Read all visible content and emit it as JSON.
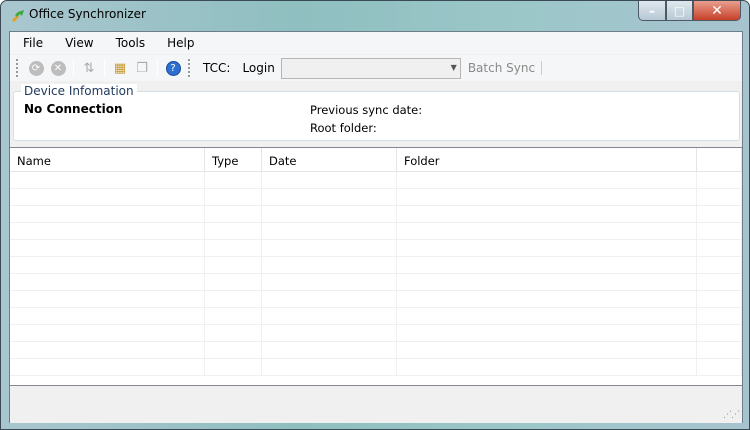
{
  "window": {
    "title": "Office Synchronizer",
    "minimize": "–",
    "maximize": "□",
    "close": "✕"
  },
  "menu": [
    "File",
    "View",
    "Tools",
    "Help"
  ],
  "toolbar": {
    "tcc_label": "TCC:",
    "login_label": "Login",
    "combo_value": "",
    "batch_sync": "Batch Sync"
  },
  "device": {
    "group_label": "Device Infomation",
    "status": "No Connection",
    "previous_sync_label": "Previous sync date:",
    "root_folder_label": "Root folder:"
  },
  "list": {
    "columns": [
      "Name",
      "Type",
      "Date",
      "Folder",
      ""
    ],
    "rows": []
  }
}
